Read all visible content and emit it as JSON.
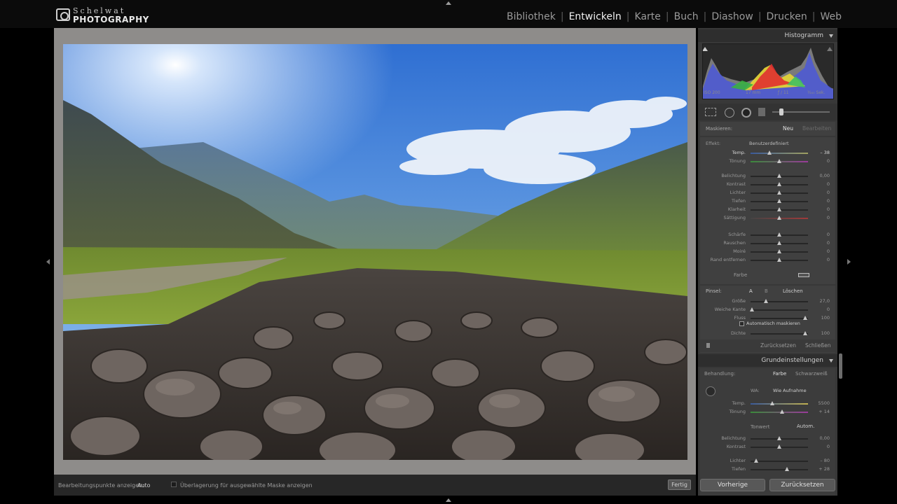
{
  "brand": {
    "line1": "Schelwat",
    "line2": "PHOTOGRAPHY"
  },
  "modules": [
    {
      "label": "Bibliothek",
      "active": false
    },
    {
      "label": "Entwickeln",
      "active": true
    },
    {
      "label": "Karte",
      "active": false
    },
    {
      "label": "Buch",
      "active": false
    },
    {
      "label": "Diashow",
      "active": false
    },
    {
      "label": "Drucken",
      "active": false
    },
    {
      "label": "Web",
      "active": false
    }
  ],
  "histogram": {
    "title": "Histogramm",
    "iso": "ISO 200",
    "focal": "17 mm",
    "aperture": "ƒ / 11",
    "shutter": "¹⁄₂₀₀ Sek."
  },
  "mask_panel": {
    "label": "Maskieren:",
    "new": "Neu",
    "edit": "Bearbeiten",
    "effect_label": "Effekt:",
    "effect_value": "Benutzerdefiniert",
    "color_label": "Farbe",
    "sliders": [
      {
        "label": "Temp.",
        "value": "– 38",
        "pos": 0.33,
        "highlight": true
      },
      {
        "label": "Tönung",
        "value": "0",
        "pos": 0.5,
        "highlight": false
      },
      {
        "label": "Belichtung",
        "value": "0,00",
        "pos": 0.5,
        "highlight": false
      },
      {
        "label": "Kontrast",
        "value": "0",
        "pos": 0.5,
        "highlight": false
      },
      {
        "label": "Lichter",
        "value": "0",
        "pos": 0.5,
        "highlight": false
      },
      {
        "label": "Tiefen",
        "value": "0",
        "pos": 0.5,
        "highlight": false
      },
      {
        "label": "Klarheit",
        "value": "0",
        "pos": 0.5,
        "highlight": false
      },
      {
        "label": "Sättigung",
        "value": "0",
        "pos": 0.5,
        "highlight": false
      },
      {
        "label": "Schärfe",
        "value": "0",
        "pos": 0.5,
        "highlight": false
      },
      {
        "label": "Rauschen",
        "value": "0",
        "pos": 0.5,
        "highlight": false
      },
      {
        "label": "Moiré",
        "value": "0",
        "pos": 0.5,
        "highlight": false
      },
      {
        "label": "Rand entfernen",
        "value": "0",
        "pos": 0.5,
        "highlight": false
      }
    ]
  },
  "brush_panel": {
    "label": "Pinsel:",
    "a": "A",
    "b": "B",
    "erase": "Löschen",
    "sliders": [
      {
        "label": "Größe",
        "value": "27,0",
        "pos": 0.27
      },
      {
        "label": "Weiche Kante",
        "value": "0",
        "pos": 0.03
      },
      {
        "label": "Fluss",
        "value": "100",
        "pos": 0.95
      }
    ],
    "auto_mask": "Automatisch maskieren",
    "density": {
      "label": "Dichte",
      "value": "100",
      "pos": 0.95
    },
    "reset": "Zurücksetzen",
    "close": "Schließen"
  },
  "basic_panel": {
    "title": "Grundeinstellungen",
    "treatment_label": "Behandlung:",
    "color": "Farbe",
    "bw": "Schwarzweiß",
    "wb_label": "WA:",
    "wb_value": "Wie Aufnahme",
    "temp": {
      "label": "Temp.",
      "value": "5500",
      "pos": 0.38
    },
    "tint": {
      "label": "Tönung",
      "value": "+ 14",
      "pos": 0.55
    },
    "tone_label": "Tonwert",
    "auto": "Autom.",
    "exposure": {
      "label": "Belichtung",
      "value": "0,00",
      "pos": 0.5
    },
    "contrast": {
      "label": "Kontrast",
      "value": "0",
      "pos": 0.5
    },
    "highlights": {
      "label": "Lichter",
      "value": "– 80",
      "pos": 0.1
    },
    "shadows": {
      "label": "Tiefen",
      "value": "+ 28",
      "pos": 0.64
    }
  },
  "toolbar": {
    "edit_points_label": "Bearbeitungspunkte anzeigen:",
    "edit_points_value": "Auto",
    "overlay_label": "Überlagerung für ausgewählte Maske anzeigen",
    "done": "Fertig"
  },
  "buttons": {
    "previous": "Vorherige",
    "reset": "Zurücksetzen"
  }
}
